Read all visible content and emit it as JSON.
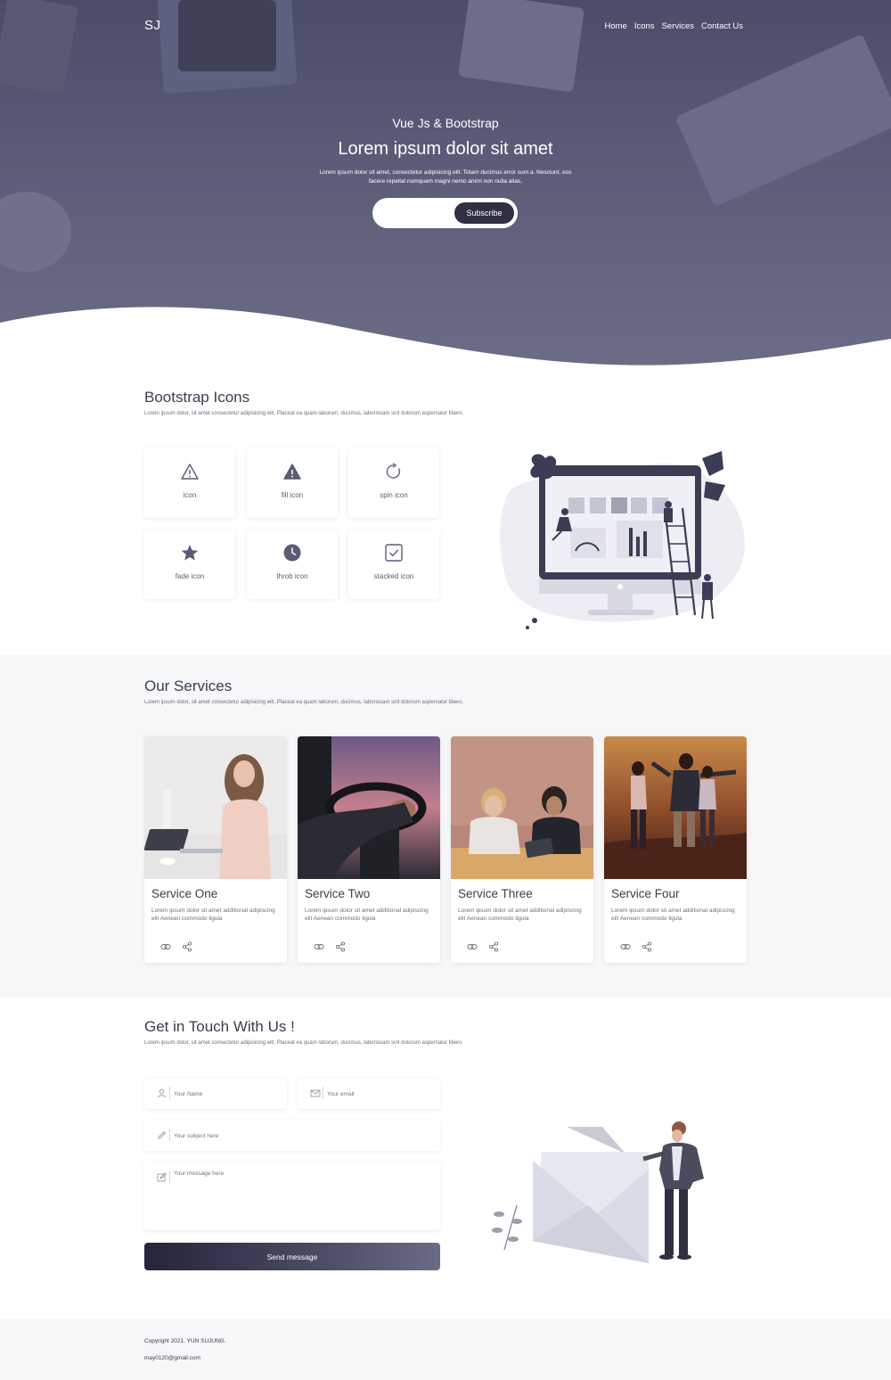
{
  "brand": "SJ",
  "nav": [
    "Home",
    "Icons",
    "Services",
    "Contact Us"
  ],
  "hero": {
    "subtitle": "Vue Js & Bootstrap",
    "title": "Lorem ipsum dolor sit amet",
    "text": "Lorem ipsum dolor sit amet, consectetur adipisicing elit. Totam ducimus error sunt a. Nesciunt, eos facere repellat numquam magni nemo animi non nulla alias,",
    "subscribe_label": "Subscribe"
  },
  "icons_section": {
    "title": "Bootstrap Icons",
    "desc": "Lorem ipsum dolor, sit amet consectetur adipisicing elit. Placeat ea quam laborum, ducimus, laboriosam sint dolorum aspernatur libero.",
    "items": [
      {
        "label": "icon",
        "icon": "warning-outline-icon"
      },
      {
        "label": "fill icon",
        "icon": "warning-fill-icon"
      },
      {
        "label": "spin icon",
        "icon": "refresh-icon"
      },
      {
        "label": "fade icon",
        "icon": "star-icon"
      },
      {
        "label": "throb icon",
        "icon": "clock-icon"
      },
      {
        "label": "stacked icon",
        "icon": "checkbox-icon"
      }
    ]
  },
  "services_section": {
    "title": "Our Services",
    "desc": "Lorem ipsum dolor, sit amet consectetur adipisicing elit. Placeat ea quam laborum, ducimus, laboriosam sint dolorum aspernatur libero.",
    "cards": [
      {
        "title": "Service One",
        "text": "Lorem ipsum dolor sit amet additional adipiscing elit Aenean commodo ligula"
      },
      {
        "title": "Service Two",
        "text": "Lorem ipsum dolor sit amet additional adipiscing elit Aenean commodo ligula"
      },
      {
        "title": "Service Three",
        "text": "Lorem ipsum dolor sit amet additional adipiscing elit Aenean commodo ligula"
      },
      {
        "title": "Service Four",
        "text": "Lorem ipsum dolor sit amet additional adipiscing elit Aenean commodo ligula"
      }
    ]
  },
  "contact_section": {
    "title": "Get in Touch With Us !",
    "desc": "Lorem ipsum dolor, sit amet consectetur adipisicing elit. Placeat ea quam laborum, ducimus, laboriosam sint dolorum aspernatur libero",
    "name_placeholder": "Your Name",
    "email_placeholder": "Your email",
    "subject_placeholder": "Your subject here",
    "message_placeholder": "Your message here",
    "send_label": "Send message"
  },
  "footer": {
    "copyright": "Copyright 2021. YUN SUJUNG.",
    "email": "may0120@gmail.com"
  },
  "colors": {
    "accent": "#303042",
    "hero": "#4a4c68",
    "section_bg": "#f6f7f9"
  }
}
